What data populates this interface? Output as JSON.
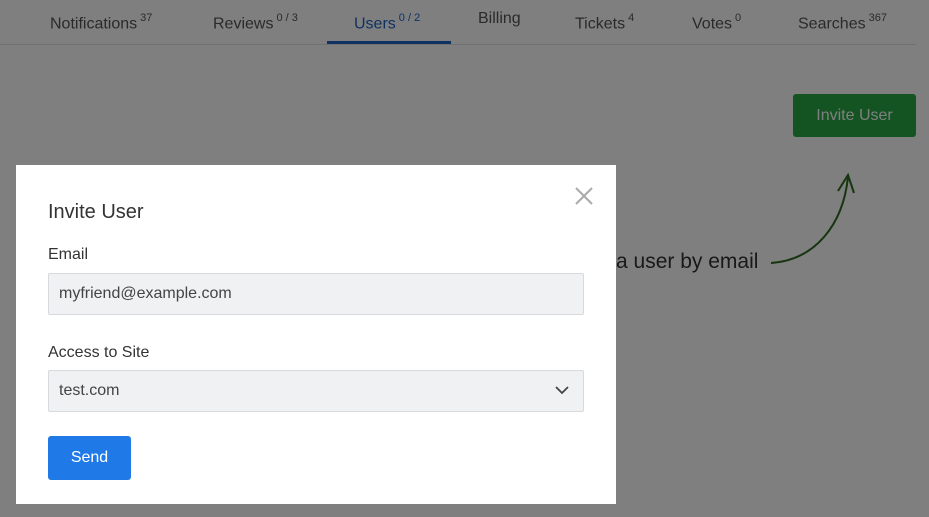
{
  "tabs": [
    {
      "label": "Notifications",
      "count": "37"
    },
    {
      "label": "Reviews",
      "count": "0 / 3"
    },
    {
      "label": "Users",
      "count": "0 / 2",
      "active": true
    },
    {
      "label": "Billing",
      "count": ""
    },
    {
      "label": "Tickets",
      "count": "4"
    },
    {
      "label": "Votes",
      "count": "0"
    },
    {
      "label": "Searches",
      "count": "367"
    }
  ],
  "page": {
    "invite_button": "Invite User",
    "hint_text": "Invite a user by email"
  },
  "modal": {
    "title": "Invite User",
    "email_label": "Email",
    "email_value": "myfriend@example.com",
    "access_label": "Access to Site",
    "access_value": "test.com",
    "send_label": "Send",
    "close_icon": "close-icon",
    "dropdown_icon": "chevron-down-icon"
  },
  "colors": {
    "accent": "#1c63c4",
    "primary_button": "#1f7ae8",
    "success_button": "#28a745",
    "overlay": "rgba(0,0,0,0.5)"
  }
}
